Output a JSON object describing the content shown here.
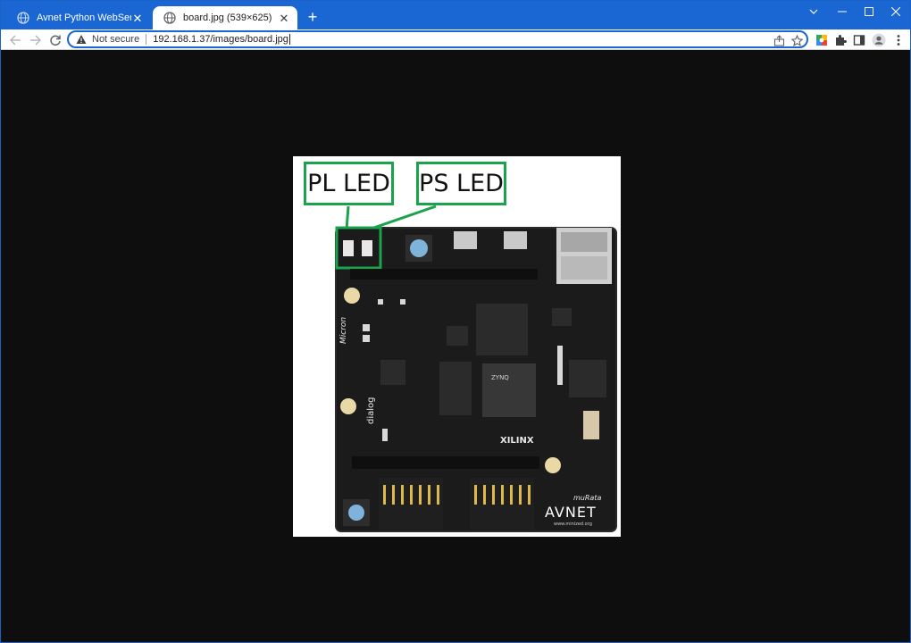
{
  "tabs": [
    {
      "title": "Avnet Python WebServer Demo",
      "active": false,
      "favicon": "globe-icon"
    },
    {
      "title": "board.jpg (539×625)",
      "active": true,
      "favicon": "globe-icon"
    }
  ],
  "address_bar": {
    "security_label": "Not secure",
    "url": "192.168.1.37/images/board.jpg"
  },
  "image": {
    "callouts": [
      "PL LED",
      "PS LED"
    ],
    "labels": {
      "brand": "AVNET",
      "brand_sub": "www.minized.org",
      "fpga": "XILINX",
      "zynq": "ZYNQ",
      "micron": "Micron",
      "dialog": "dialog",
      "murata": "muRata"
    }
  },
  "colors": {
    "titlebar": "#1a66d2",
    "callout_border": "#1aa34a",
    "pcb": "#1b1b1c",
    "page_bg": "#0e0e0e"
  }
}
